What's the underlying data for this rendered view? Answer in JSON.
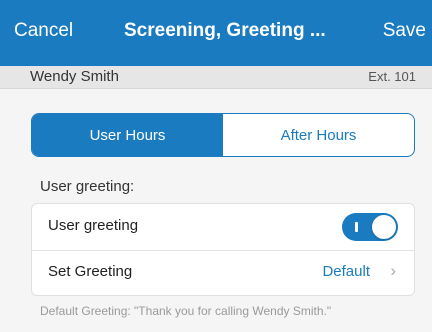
{
  "header": {
    "cancel_label": "Cancel",
    "title": "Screening, Greeting ...",
    "save_label": "Save"
  },
  "user": {
    "name": "Wendy Smith",
    "extension": "Ext. 101"
  },
  "segmented": {
    "tabs": [
      "User Hours",
      "After Hours"
    ],
    "selected": "User Hours"
  },
  "section": {
    "label": "User greeting:"
  },
  "settings": {
    "user_greeting": {
      "label": "User greeting",
      "enabled": true
    },
    "set_greeting": {
      "label": "Set Greeting",
      "value": "Default",
      "chevron_icon": "chevron-right-icon"
    }
  },
  "footnote": "Default Greeting: \"Thank you for calling Wendy Smith.\"",
  "colors": {
    "accent": "#1a7bc0",
    "background": "#f5f5f5"
  }
}
